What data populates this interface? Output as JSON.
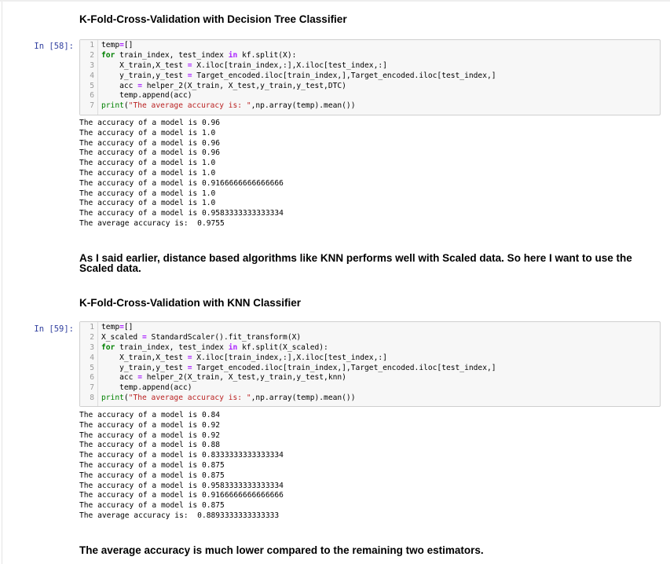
{
  "headings": {
    "dtc": "K-Fold-Cross-Validation with Decision Tree Classifier",
    "knn": "K-Fold-Cross-Validation with KNN Classifier"
  },
  "paragraphs": {
    "scaled_line1": "As I said earlier, distance based algorithms like KNN performs well with Scaled data. So here I want to use the",
    "scaled_line2": "Scaled data.",
    "conclusion": "The average accuracy is much lower compared to the remaining two estimators."
  },
  "cells": [
    {
      "prompt": "In [58]:",
      "code": [
        "temp=[]",
        "for train_index, test_index in kf.split(X):",
        "    X_train,X_test = X.iloc[train_index,:],X.iloc[test_index,:]",
        "    y_train,y_test = Target_encoded.iloc[train_index,],Target_encoded.iloc[test_index,]",
        "    acc = helper_2(X_train, X_test,y_train,y_test,DTC)",
        "    temp.append(acc)",
        "print(\"The average accuracy is: \",np.array(temp).mean())"
      ],
      "output": [
        "The accuracy of a model is 0.96",
        "The accuracy of a model is 1.0",
        "The accuracy of a model is 0.96",
        "The accuracy of a model is 0.96",
        "The accuracy of a model is 1.0",
        "The accuracy of a model is 1.0",
        "The accuracy of a model is 0.9166666666666666",
        "The accuracy of a model is 1.0",
        "The accuracy of a model is 1.0",
        "The accuracy of a model is 0.9583333333333334",
        "The average accuracy is:  0.9755"
      ]
    },
    {
      "prompt": "In [59]:",
      "code": [
        "temp=[]",
        "X_scaled = StandardScaler().fit_transform(X)",
        "for train_index, test_index in kf.split(X_scaled):",
        "    X_train,X_test = X.iloc[train_index,:],X.iloc[test_index,:]",
        "    y_train,y_test = Target_encoded.iloc[train_index,],Target_encoded.iloc[test_index,]",
        "    acc = helper_2(X_train, X_test,y_train,y_test,knn)",
        "    temp.append(acc)",
        "print(\"The average accuracy is: \",np.array(temp).mean())"
      ],
      "output": [
        "The accuracy of a model is 0.84",
        "The accuracy of a model is 0.92",
        "The accuracy of a model is 0.92",
        "The accuracy of a model is 0.88",
        "The accuracy of a model is 0.8333333333333334",
        "The accuracy of a model is 0.875",
        "The accuracy of a model is 0.875",
        "The accuracy of a model is 0.9583333333333334",
        "The accuracy of a model is 0.9166666666666666",
        "The accuracy of a model is 0.875",
        "The average accuracy is:  0.8893333333333333"
      ]
    }
  ]
}
